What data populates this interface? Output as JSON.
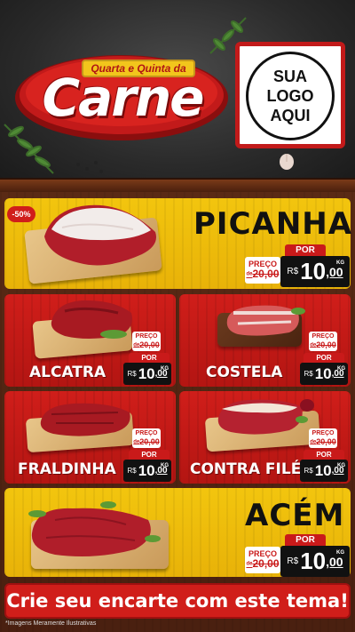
{
  "header": {
    "banner_small": "Quarta e Quinta da",
    "banner_title": "Carne",
    "logo_lines": [
      "SUA",
      "LOGO",
      "AQUI"
    ]
  },
  "colors": {
    "yellow_panel": "#f2c50e",
    "red_panel": "#d01e1a",
    "price_black": "#111111",
    "accent_red": "#c91a1a"
  },
  "currency": "R$",
  "unit": "KG",
  "preco_label": "PREÇO",
  "por_label": "POR",
  "old_prefix": "de",
  "products": {
    "picanha": {
      "name": "PICANHA",
      "discount": "-50%",
      "old_price": "20,00",
      "price_int": "10",
      "price_dec": ",00"
    },
    "alcatra": {
      "name": "ALCATRA",
      "old_price": "20,00",
      "price_int": "10",
      "price_dec": ",00"
    },
    "costela": {
      "name": "COSTELA",
      "old_price": "20,00",
      "price_int": "10",
      "price_dec": ",00"
    },
    "fraldinha": {
      "name": "FRALDINHA",
      "old_price": "20,00",
      "price_int": "10",
      "price_dec": ",00"
    },
    "contra_file": {
      "name": "CONTRA FILÉ",
      "old_price": "20,00",
      "price_int": "10",
      "price_dec": ",00"
    },
    "acem": {
      "name": "ACÉM",
      "old_price": "20,00",
      "price_int": "10",
      "price_dec": ",00"
    }
  },
  "cta_label": "Crie seu encarte com este tema!",
  "footnote": "*Imagens Meramente Ilustrativas"
}
